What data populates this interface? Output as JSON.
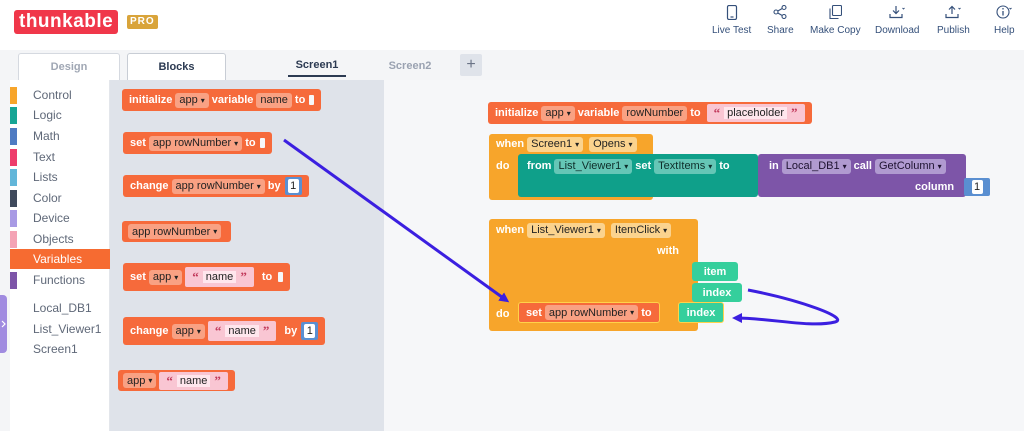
{
  "brand": {
    "logo": "thunkable",
    "badge": "PRO"
  },
  "toolbar": [
    {
      "label": "Live Test",
      "icon": "phone-icon"
    },
    {
      "label": "Share",
      "icon": "share-icon"
    },
    {
      "label": "Make Copy",
      "icon": "copy-icon"
    },
    {
      "label": "Download",
      "icon": "download-icon"
    },
    {
      "label": "Publish",
      "icon": "upload-icon"
    },
    {
      "label": "Help",
      "icon": "info-icon"
    }
  ],
  "mode_tabs": {
    "design": "Design",
    "blocks": "Blocks"
  },
  "screen_tabs": {
    "screen1": "Screen1",
    "screen2": "Screen2",
    "add": "+"
  },
  "categories": [
    {
      "label": "Control",
      "color": "#f7a52b"
    },
    {
      "label": "Logic",
      "color": "#16a595"
    },
    {
      "label": "Math",
      "color": "#4f7bc2"
    },
    {
      "label": "Text",
      "color": "#ee3d6b"
    },
    {
      "label": "Lists",
      "color": "#62b6d9"
    },
    {
      "label": "Color",
      "color": "#3f4a5c"
    },
    {
      "label": "Device",
      "color": "#a89ae4"
    },
    {
      "label": "Objects",
      "color": "#f4a3b5"
    },
    {
      "label": "Variables",
      "color": "#f66b31"
    },
    {
      "label": "Functions",
      "color": "#7d55a8"
    }
  ],
  "components": [
    "Local_DB1",
    "List_Viewer1",
    "Screen1"
  ],
  "flyout": {
    "init": {
      "kw": "initialize",
      "scope": "app",
      "mid": "variable",
      "name": "name",
      "to": "to"
    },
    "set": {
      "kw": "set",
      "var": "app rowNumber",
      "to": "to"
    },
    "change": {
      "kw": "change",
      "var": "app rowNumber",
      "by": "by",
      "num": "1"
    },
    "get": {
      "var": "app rowNumber"
    },
    "set_obj": {
      "kw": "set",
      "scope": "app",
      "str": "name",
      "to": "to"
    },
    "change_obj": {
      "kw": "change",
      "scope": "app",
      "str": "name",
      "by": "by",
      "num": "1"
    },
    "get_obj": {
      "scope": "app",
      "str": "name"
    }
  },
  "workspace": {
    "init": {
      "kw": "initialize",
      "scope": "app",
      "mid": "variable",
      "name": "rowNumber",
      "to": "to",
      "str": "placeholder"
    },
    "opens": {
      "when": "when",
      "comp": "Screen1",
      "event": "Opens",
      "do": "do"
    },
    "setlist": {
      "from": "from",
      "comp": "List_Viewer1",
      "set": "set",
      "prop": "TextItems",
      "to": "to",
      "in": "in",
      "db": "Local_DB1",
      "call": "call",
      "method": "GetColumn",
      "column": "column",
      "num": "1"
    },
    "click": {
      "when": "when",
      "comp": "List_Viewer1",
      "event": "ItemClick",
      "with": "with",
      "p1": "item",
      "p2": "index",
      "do": "do"
    },
    "setrow": {
      "kw": "set",
      "var": "app rowNumber",
      "to": "to",
      "index": "index"
    }
  },
  "colors": {
    "accent": "#f0374a",
    "arrow": "#3b1fe0",
    "pro": "#d9a43a"
  }
}
